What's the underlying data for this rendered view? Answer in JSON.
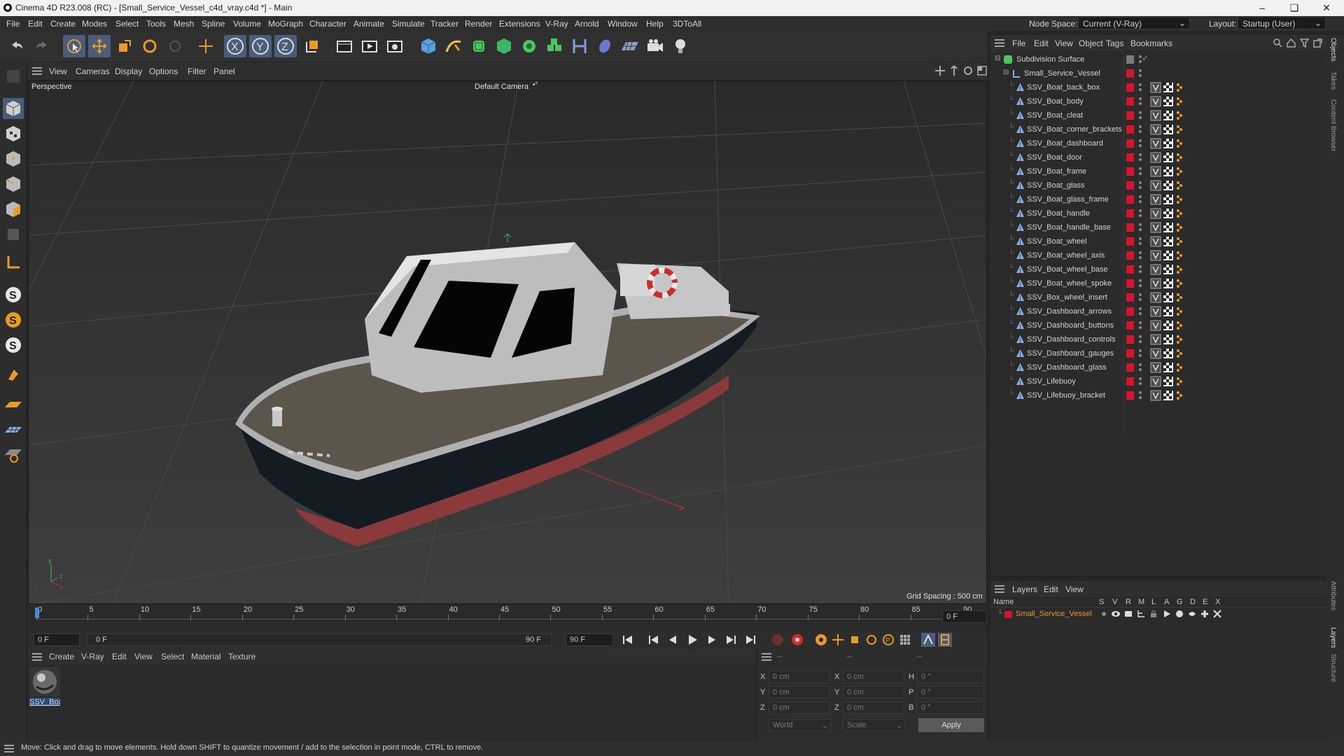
{
  "titlebar": {
    "title": "Cinema 4D R23.008 (RC) - [Small_Service_Vessel_c4d_vray.c4d *] - Main"
  },
  "menu": {
    "items": [
      "File",
      "Edit",
      "Create",
      "Modes",
      "Select",
      "Tools",
      "Mesh",
      "Spline",
      "Volume",
      "MoGraph",
      "Character",
      "Animate",
      "Simulate",
      "Tracker",
      "Render",
      "Extensions",
      "V-Ray",
      "Arnold",
      "Window",
      "Help",
      "3DToAll"
    ],
    "node_space_label": "Node Space:",
    "node_space_value": "Current (V-Ray)",
    "layout_label": "Layout:",
    "layout_value": "Startup (User)"
  },
  "viewport": {
    "menu": [
      "View",
      "Cameras",
      "Display",
      "Options",
      "Filter",
      "Panel"
    ],
    "name": "Perspective",
    "camera": "Default Camera",
    "grid_spacing": "Grid Spacing : 500 cm"
  },
  "timeline": {
    "ticks": [
      "0",
      "5",
      "10",
      "15",
      "20",
      "25",
      "30",
      "35",
      "40",
      "45",
      "50",
      "55",
      "60",
      "65",
      "70",
      "75",
      "80",
      "85",
      "90"
    ],
    "current_frame": "0 F"
  },
  "transport": {
    "start": "0 F",
    "range_start": "0 F",
    "range_end": "90 F",
    "end": "90 F"
  },
  "material": {
    "menu": [
      "Create",
      "V-Ray",
      "Edit",
      "View",
      "Select",
      "Material",
      "Texture"
    ],
    "items": [
      {
        "name": "SSV_Boa"
      }
    ]
  },
  "coords": {
    "headers": [
      "--",
      "--",
      "--"
    ],
    "rows": [
      {
        "a": "X",
        "av": "0 cm",
        "b": "X",
        "bv": "0 cm",
        "c": "H",
        "cv": "0 °"
      },
      {
        "a": "Y",
        "av": "0 cm",
        "b": "Y",
        "bv": "0 cm",
        "c": "P",
        "cv": "0 °"
      },
      {
        "a": "Z",
        "av": "0 cm",
        "b": "Z",
        "bv": "0 cm",
        "c": "B",
        "cv": "0 °"
      }
    ],
    "space": "World",
    "mode": "Scale",
    "apply": "Apply"
  },
  "objects": {
    "menu": [
      "File",
      "Edit",
      "View",
      "Object",
      "Tags",
      "Bookmarks"
    ],
    "root": "Subdivision Surface",
    "group": "Small_Service_Vessel",
    "items": [
      "SSV_Boat_back_box",
      "SSV_Boat_body",
      "SSV_Boat_cleat",
      "SSV_Boat_corner_brackets",
      "SSV_Boat_dashboard",
      "SSV_Boat_door",
      "SSV_Boat_frame",
      "SSV_Boat_glass",
      "SSV_Boat_glass_frame",
      "SSV_Boat_handle",
      "SSV_Boat_handle_base",
      "SSV_Boat_wheel",
      "SSV_Boat_wheel_axis",
      "SSV_Boat_wheel_base",
      "SSV_Boat_wheel_spoke",
      "SSV_Box_wheel_insert",
      "SSV_Dashboard_arrows",
      "SSV_Dashboard_buttons",
      "SSV_Dashboard_controls",
      "SSV_Dashboard_gauges",
      "SSV_Dashboard_glass",
      "SSV_Lifebuoy",
      "SSV_Lifebuoy_bracket"
    ]
  },
  "layers": {
    "menu": [
      "Layers",
      "Edit",
      "View"
    ],
    "columns": [
      "Name",
      "S",
      "V",
      "R",
      "M",
      "L",
      "A",
      "G",
      "D",
      "E",
      "X"
    ],
    "items": [
      {
        "name": "Small_Service_Vessel",
        "color": "#d6142b"
      }
    ]
  },
  "right_tabs": [
    "Objects",
    "Takes",
    "Content Browser",
    "Attributes",
    "Layers",
    "Structure"
  ],
  "status": "Move: Click and drag to move elements. Hold down SHIFT to quantize movement / add to the selection in point mode, CTRL to remove."
}
